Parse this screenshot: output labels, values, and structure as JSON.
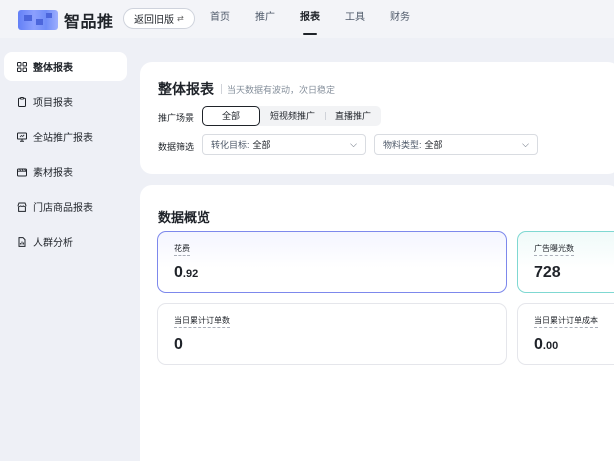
{
  "header": {
    "app_name": "智品推",
    "back_button": "返回旧版",
    "nav": [
      {
        "label": "首页",
        "active": false
      },
      {
        "label": "推广",
        "active": false
      },
      {
        "label": "报表",
        "active": true
      },
      {
        "label": "工具",
        "active": false
      },
      {
        "label": "财务",
        "active": false
      }
    ]
  },
  "sidebar": {
    "items": [
      {
        "label": "整体报表",
        "icon": "grid-icon",
        "active": true
      },
      {
        "label": "项目报表",
        "icon": "clipboard-icon",
        "active": false
      },
      {
        "label": "全站推广报表",
        "icon": "monitor-icon",
        "active": false
      },
      {
        "label": "素材报表",
        "icon": "film-icon",
        "active": false
      },
      {
        "label": "门店商品报表",
        "icon": "store-icon",
        "active": false
      },
      {
        "label": "人群分析",
        "icon": "document-icon",
        "active": false
      }
    ]
  },
  "report": {
    "title": "整体报表",
    "subtitle": "当天数据有波动，次日稳定",
    "scene_label": "推广场景",
    "scene_tabs": [
      {
        "label": "全部",
        "active": true
      },
      {
        "label": "短视频推广",
        "active": false
      },
      {
        "label": "直播推广",
        "active": false
      }
    ],
    "filter_label": "数据筛选",
    "filters": [
      {
        "label": "转化目标:",
        "value": "全部"
      },
      {
        "label": "物料类型:",
        "value": "全部"
      }
    ]
  },
  "overview": {
    "title": "数据概览",
    "metrics": [
      {
        "label": "花费",
        "value_int": "0",
        "value_dec": ".92",
        "state": "selected"
      },
      {
        "label": "广告曝光数",
        "value_int": "728",
        "value_dec": "",
        "state": "teal"
      },
      {
        "label": "当日累计订单数",
        "value_int": "0",
        "value_dec": "",
        "state": "normal"
      },
      {
        "label": "当日累计订单成本",
        "value_int": "0",
        "value_dec": ".00",
        "state": "normal"
      }
    ]
  },
  "colors": {
    "background": "#eef0f6",
    "selected_border": "#7d88ec",
    "teal_border": "#7fd8d2",
    "text": "#1f2329"
  }
}
